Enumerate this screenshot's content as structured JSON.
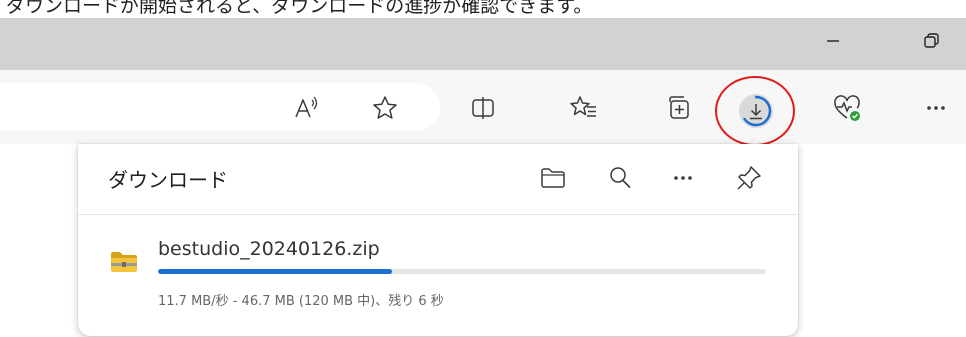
{
  "caption": {
    "text": "ダウンロードが開始されると、ダウンロードの進捗が確認できます。"
  },
  "icons": {
    "minimize": "minimize-icon",
    "restore": "restore-icon",
    "read_aloud": "read-aloud-icon",
    "favorite": "star-icon",
    "split_screen": "split-screen-icon",
    "favorites_list": "favorites-list-icon",
    "collections": "collections-icon",
    "downloads": "download-icon",
    "browser_health": "browser-health-icon",
    "more": "more-icon",
    "open_folder": "folder-icon",
    "search": "search-icon",
    "panel_more": "more-icon",
    "pin": "pin-icon",
    "file": "zip-folder-icon"
  },
  "colors": {
    "accent": "#1a6fd1",
    "highlight": "#e11a1a",
    "health_badge": "#2e9d3a"
  },
  "downloads_panel": {
    "title": "ダウンロード",
    "items": [
      {
        "file_name": "bestudio_20240126.zip",
        "progress": 0.385,
        "status": "11.7 MB/秒 - 46.7 MB (120 MB 中)、残り 6 秒"
      }
    ]
  }
}
